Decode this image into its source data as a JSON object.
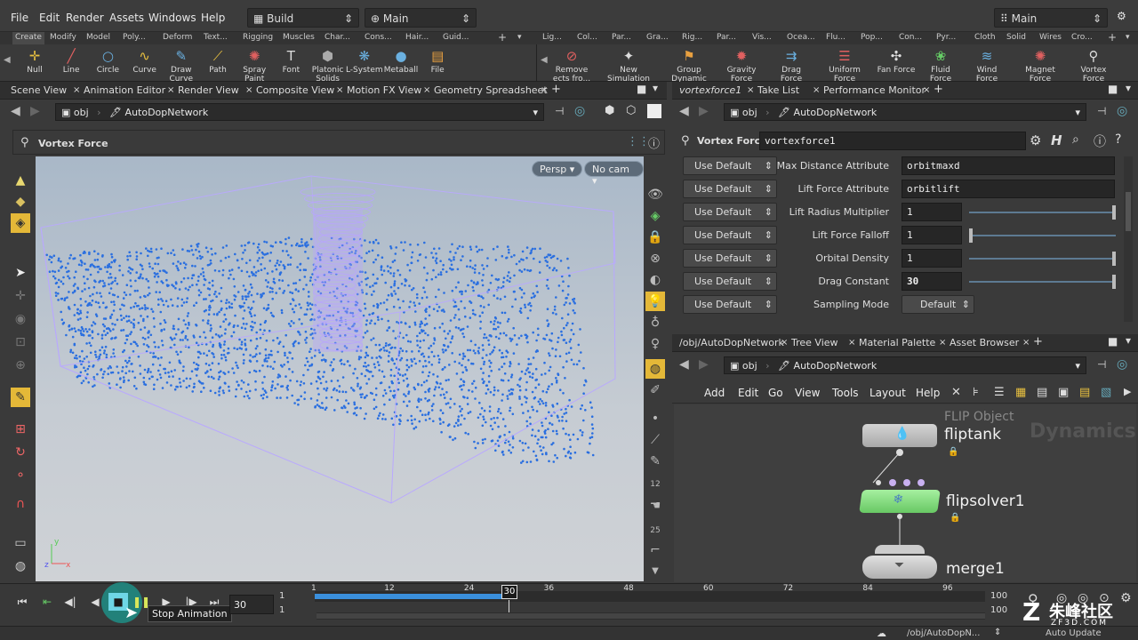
{
  "menu": {
    "file": "File",
    "edit": "Edit",
    "render": "Render",
    "assets": "Assets",
    "windows": "Windows",
    "help": "Help",
    "desktop": "Build",
    "context": "Main",
    "right_desktop": "Main"
  },
  "shelf_tabs_left": [
    "Create",
    "Modify",
    "Model",
    "Poly...",
    "Deform",
    "Text...",
    "Rigging",
    "Muscles",
    "Char...",
    "Cons...",
    "Hair...",
    "Guid..."
  ],
  "shelf_tabs_right": [
    "Lig...",
    "Col...",
    "Par...",
    "Gra...",
    "Rig...",
    "Par...",
    "Vis...",
    "Ocea...",
    "Flu...",
    "Pop...",
    "Con...",
    "Pyr...",
    "Cloth",
    "Solid",
    "Wires",
    "Cro..."
  ],
  "tools_left": [
    "Null",
    "Line",
    "Circle",
    "Curve",
    "Draw Curve",
    "Path",
    "Spray Paint",
    "Font",
    "Platonic Solids",
    "L-System",
    "Metaball",
    "File"
  ],
  "tools_right": [
    "Remove ects fro...",
    "New Simulation",
    "Group Dynamic Ob...",
    "Gravity Force",
    "Drag Force",
    "Uniform Force",
    "Fan Force",
    "Fluid Force",
    "Wind Force",
    "Magnet Force",
    "Vortex Force"
  ],
  "left_tabs": [
    "Scene View",
    "Animation Editor",
    "Render View",
    "Composite View",
    "Motion FX View",
    "Geometry Spreadsheet"
  ],
  "left_path": {
    "obj": "obj",
    "node": "AutoDopNetwork"
  },
  "operator_title": "Vortex Force",
  "viewport": {
    "persp": "Persp",
    "cam": "No cam"
  },
  "right_tabs": [
    "vortexforce1",
    "Take List",
    "Performance Monitor"
  ],
  "right_path": {
    "obj": "obj",
    "node": "AutoDopNetwork"
  },
  "param_header": {
    "type": "Vortex Force",
    "name": "vortexforce1"
  },
  "params": [
    {
      "btn": "Use Default",
      "label": "Max Distance Attribute",
      "value": "orbitmaxd",
      "slider": null
    },
    {
      "btn": "Use Default",
      "label": "Lift Force Attribute",
      "value": "orbitlift",
      "slider": null
    },
    {
      "btn": "Use Default",
      "label": "Lift Radius Multiplier",
      "value": "1",
      "slider": 1.0
    },
    {
      "btn": "Use Default",
      "label": "Lift Force Falloff",
      "value": "1",
      "slider": 0.0
    },
    {
      "btn": "Use Default",
      "label": "Orbital Density",
      "value": "1",
      "slider": 1.0
    },
    {
      "btn": "Use Default",
      "label": "Drag Constant",
      "value": "30",
      "slider": 1.0
    },
    {
      "btn": "Use Default",
      "label": "Sampling Mode",
      "value": "Default",
      "slider": null
    }
  ],
  "net_tabs": [
    "/obj/AutoDopNetwork",
    "Tree View",
    "Material Palette",
    "Asset Browser"
  ],
  "net_path": {
    "obj": "obj",
    "node": "AutoDopNetwork"
  },
  "net_menu": [
    "Add",
    "Edit",
    "Go",
    "View",
    "Tools",
    "Layout",
    "Help"
  ],
  "network": {
    "watermark": "Dynamics",
    "nodes": [
      {
        "type": "FLIP Object",
        "name": "fliptank"
      },
      {
        "name": "flipsolver1"
      },
      {
        "name": "merge1"
      }
    ]
  },
  "timeline": {
    "current": "30",
    "start": "1",
    "start2": "1",
    "end": "100",
    "end2": "100",
    "ticks": [
      "1",
      "12",
      "24",
      "30",
      "36",
      "48",
      "60",
      "72",
      "84",
      "96"
    ],
    "progress": 0.293,
    "tooltip": "Stop Animation"
  },
  "status": {
    "path": "/obj/AutoDopN...",
    "auto_update": "Auto Update",
    "watermark_cn": "朱峰社区",
    "watermark_url": "ZF3D.COM"
  },
  "colors": {
    "accent": "#5ab4e6",
    "solver_node": "#7fdc7a",
    "particle": "#2a6fe0",
    "vortex": "#b8a4ff"
  }
}
